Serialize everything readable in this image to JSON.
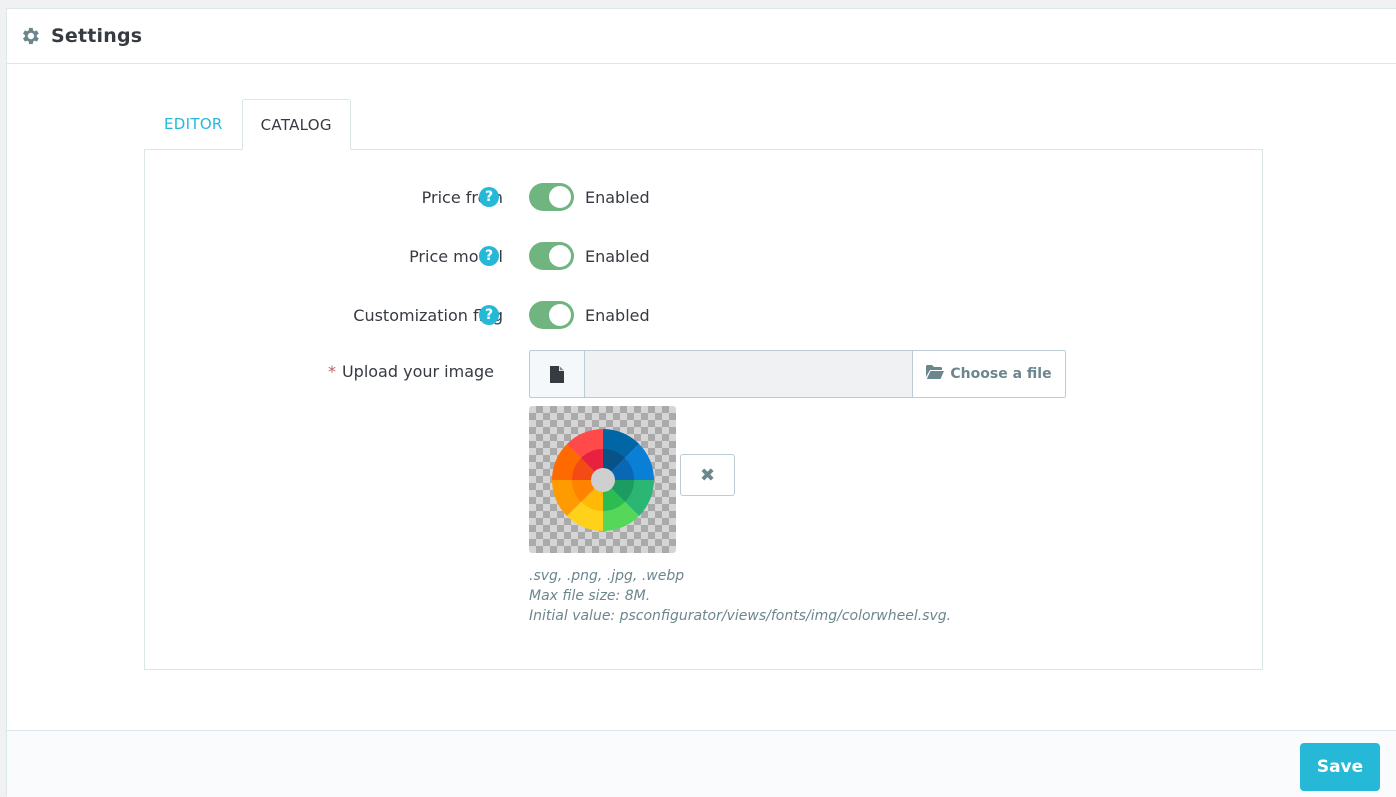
{
  "header": {
    "title": "Settings",
    "icon": "gear-icon"
  },
  "tabs": [
    {
      "label": "EDITOR",
      "active": false
    },
    {
      "label": "CATALOG",
      "active": true
    }
  ],
  "form": {
    "rows": [
      {
        "label": "Price from",
        "state": "Enabled",
        "enabled": true
      },
      {
        "label": "Price model",
        "state": "Enabled",
        "enabled": true
      },
      {
        "label": "Customization flag",
        "state": "Enabled",
        "enabled": true
      }
    ],
    "help_symbol": "?",
    "upload": {
      "required_marker": "*",
      "label": "Upload your image",
      "value": "",
      "choose_label": "Choose a file",
      "remove_symbol": "✖",
      "hints": [
        ".svg, .png, .jpg, .webp",
        "Max file size: 8M.",
        "Initial value: psconfigurator/views/fonts/img/colorwheel.svg."
      ]
    }
  },
  "footer": {
    "save_label": "Save"
  },
  "colors": {
    "accent": "#25b9d7",
    "switch_on": "#70b580",
    "required": "#c05c67"
  }
}
